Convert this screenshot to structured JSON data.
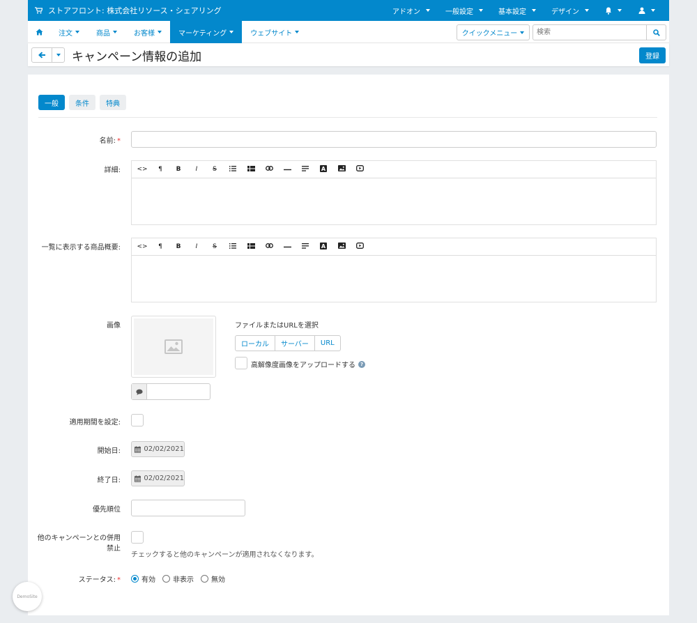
{
  "topbar": {
    "store_label": "ストアフロント: 株式会社リソース・シェアリング",
    "menus": [
      "アドオン",
      "一般設定",
      "基本設定",
      "デザイン"
    ]
  },
  "nav": {
    "items": [
      "注文",
      "商品",
      "お客様",
      "マーケティング",
      "ウェブサイト"
    ],
    "active": "マーケティング",
    "quick_menu": "クイックメニュー",
    "search_placeholder": "検索"
  },
  "title": {
    "text": "キャンペーン情報の追加",
    "save_label": "登録"
  },
  "tabs": [
    "一般",
    "条件",
    "特典"
  ],
  "form": {
    "name_label": "名前:",
    "name_value": "",
    "details_label": "詳細:",
    "summary_label": "一覧に表示する商品概要:",
    "editor_toolbar": [
      "<>",
      "¶",
      "B",
      "I",
      "S",
      "list",
      "table",
      "link",
      "hr",
      "align",
      "A",
      "image",
      "video"
    ],
    "image_label": "画像",
    "file_select_label": "ファイルまたはURLを選択",
    "source_buttons": [
      "ローカル",
      "サーバー",
      "URL"
    ],
    "hires_label": "高解像度画像をアップロードする",
    "period_label": "適用期間を設定:",
    "start_label": "開始日:",
    "start_value": "02/02/2021",
    "end_label": "終了日:",
    "end_value": "02/02/2021",
    "priority_label": "優先順位",
    "exclusive_label_1": "他のキャンペーンとの併用",
    "exclusive_label_2": "禁止",
    "exclusive_help": "チェックすると他のキャンペーンが適用されなくなります。",
    "status_label": "ステータス:",
    "status_options": [
      "有効",
      "非表示",
      "無効"
    ],
    "status_selected": "有効"
  },
  "demo_badge": "DemoSite",
  "colors": {
    "primary": "#0388cc",
    "required": "#ee3333"
  }
}
